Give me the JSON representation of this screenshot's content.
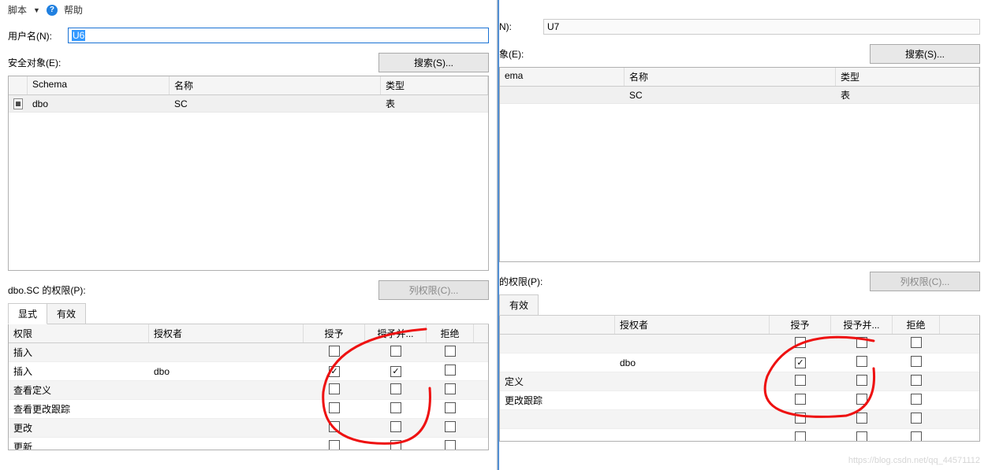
{
  "menu": {
    "script_label": "脚本",
    "help_label": "帮助"
  },
  "left": {
    "username_label": "用户名(N):",
    "username_value": "U6",
    "securables_label": "安全对象(E):",
    "search_btn": "搜索(S)...",
    "grid_headers": {
      "schema": "Schema",
      "name": "名称",
      "type": "类型"
    },
    "grid_rows": [
      {
        "schema": "dbo",
        "name": "SC",
        "type": "表"
      }
    ],
    "permissions_for": "dbo.SC 的权限(P):",
    "col_perm_btn": "列权限(C)...",
    "tabs": {
      "explicit": "显式",
      "effective": "有效"
    },
    "perm_headers": {
      "perm": "权限",
      "grantor": "授权者",
      "grant": "授予",
      "withgrant": "授予并...",
      "deny": "拒绝"
    },
    "perm_rows": [
      {
        "perm": "插入",
        "grantor": "",
        "grant": false,
        "withgrant": false,
        "deny": false
      },
      {
        "perm": "插入",
        "grantor": "dbo",
        "grant": true,
        "withgrant": true,
        "deny": false
      },
      {
        "perm": "查看定义",
        "grantor": "",
        "grant": false,
        "withgrant": false,
        "deny": false
      },
      {
        "perm": "查看更改跟踪",
        "grantor": "",
        "grant": false,
        "withgrant": false,
        "deny": false
      },
      {
        "perm": "更改",
        "grantor": "",
        "grant": false,
        "withgrant": false,
        "deny": false
      },
      {
        "perm": "更新",
        "grantor": "",
        "grant": false,
        "withgrant": false,
        "deny": false
      }
    ]
  },
  "right": {
    "username_label_partial": "N):",
    "username_value": "U7",
    "securables_label_partial": "象(E):",
    "search_btn": "搜索(S)...",
    "grid_headers": {
      "schema": "ema",
      "name": "名称",
      "type": "类型"
    },
    "grid_rows": [
      {
        "schema": "",
        "name": "SC",
        "type": "表"
      }
    ],
    "permissions_for_partial": " 的权限(P):",
    "col_perm_btn": "列权限(C)...",
    "tab_effective": "有效",
    "perm_headers": {
      "grantor": "授权者",
      "grant": "授予",
      "withgrant": "授予并...",
      "deny": "拒绝"
    },
    "perm_rows": [
      {
        "perm": "",
        "grantor": "",
        "grant": false,
        "withgrant": false,
        "deny": false
      },
      {
        "perm": "",
        "grantor": "dbo",
        "grant": true,
        "withgrant": false,
        "deny": false
      },
      {
        "perm": "定义",
        "grantor": "",
        "grant": false,
        "withgrant": false,
        "deny": false
      },
      {
        "perm": "更改跟踪",
        "grantor": "",
        "grant": false,
        "withgrant": false,
        "deny": false
      },
      {
        "perm": "",
        "grantor": "",
        "grant": false,
        "withgrant": false,
        "deny": false
      },
      {
        "perm": "",
        "grantor": "",
        "grant": false,
        "withgrant": false,
        "deny": false
      }
    ]
  },
  "watermark": "https://blog.csdn.net/qq_44571112"
}
